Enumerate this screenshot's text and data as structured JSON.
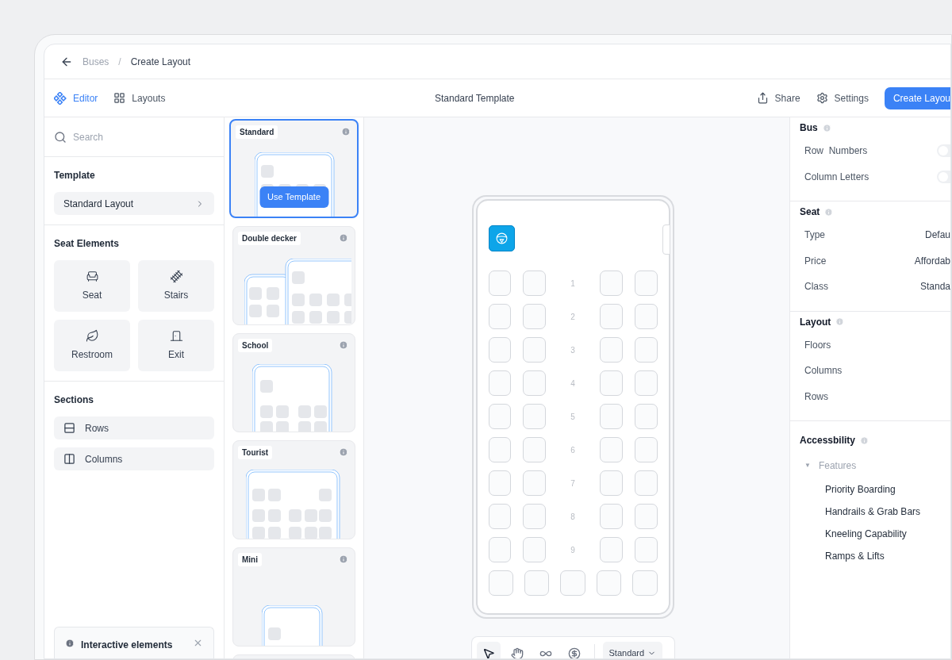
{
  "breadcrumb": {
    "separator": "/",
    "items": [
      "Buses",
      "Create Layout"
    ]
  },
  "tabs": [
    {
      "label": "Editor",
      "selected": true
    },
    {
      "label": "Layouts",
      "selected": false
    }
  ],
  "title": "Standard Template",
  "actions": [
    "Share",
    "Settings"
  ],
  "primary_button": "Create Layou",
  "search": {
    "placeholder": "Search"
  },
  "template": {
    "heading": "Template",
    "value": "Standard Layout"
  },
  "seat_elements": {
    "heading": "Seat Elements",
    "items": [
      "Seat",
      "Stairs",
      "Restroom",
      "Exit"
    ]
  },
  "sections": {
    "heading": "Sections",
    "items": [
      "Rows",
      "Columns"
    ]
  },
  "notice": {
    "title": "Interactive elements"
  },
  "templates": [
    {
      "label": "Standard",
      "selected": true,
      "button": "Use Template"
    },
    {
      "label": "Double decker",
      "selected": false
    },
    {
      "label": "School",
      "selected": false
    },
    {
      "label": "Tourist",
      "selected": false
    },
    {
      "label": "Mini",
      "selected": false
    }
  ],
  "canvas": {
    "row_numbers": [
      "1",
      "2",
      "3",
      "4",
      "5",
      "6",
      "7",
      "8",
      "9"
    ],
    "tools": [
      {
        "selected": true
      },
      {
        "selected": false
      },
      {
        "selected": false
      },
      {
        "selected": false
      }
    ],
    "dropdown": "Standard"
  },
  "properties": [
    {
      "heading": "Bus",
      "rows": [
        {
          "kind": "toggle",
          "label": "Row  Numbers",
          "on": false
        },
        {
          "kind": "toggle",
          "label": "Column Letters",
          "on": false
        }
      ]
    },
    {
      "heading": "Seat",
      "rows": [
        {
          "kind": "value",
          "label": "Type",
          "value": "Defau"
        },
        {
          "kind": "value",
          "label": "Price",
          "value": "Affordab"
        },
        {
          "kind": "value",
          "label": "Class",
          "value": "Standa"
        }
      ]
    },
    {
      "heading": "Layout",
      "rows": [
        {
          "kind": "value",
          "label": "Floors"
        },
        {
          "kind": "value",
          "label": "Columns"
        },
        {
          "kind": "value",
          "label": "Rows"
        }
      ]
    }
  ],
  "accessibility": {
    "heading": "Accessbility",
    "group": "Features",
    "expanded": true,
    "toggle_glyph": "▼",
    "items": [
      "Priority Boarding",
      "Handrails & Grab Bars",
      "Kneeling Capability",
      "Ramps & Lifts"
    ]
  }
}
